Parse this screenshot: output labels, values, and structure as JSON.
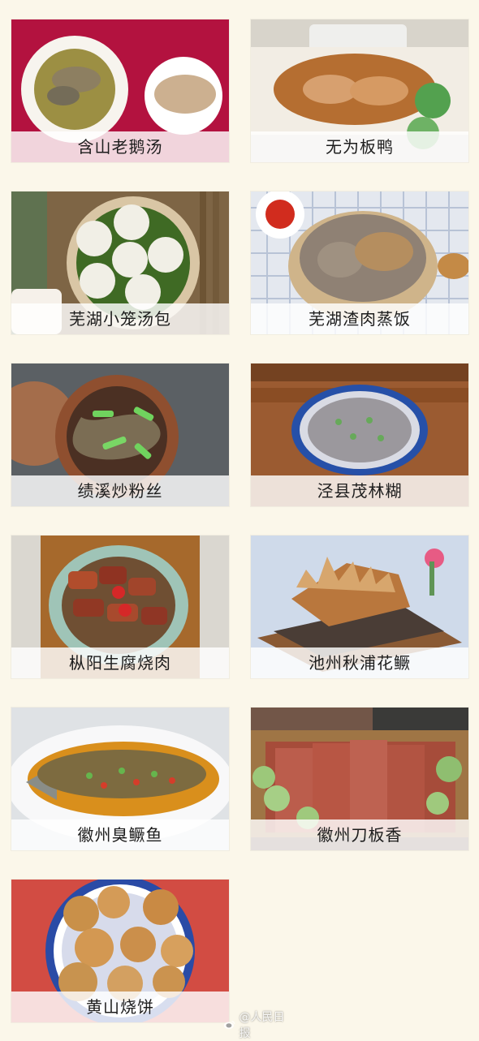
{
  "page": {
    "background_color": "#fbf7ea"
  },
  "dishes": [
    {
      "label": "含山老鹅汤"
    },
    {
      "label": "无为板鸭"
    },
    {
      "label": "芜湖小笼汤包"
    },
    {
      "label": "芜湖渣肉蒸饭"
    },
    {
      "label": "绩溪炒粉丝"
    },
    {
      "label": "泾县茂林糊"
    },
    {
      "label": "枞阳生腐烧肉"
    },
    {
      "label": "池州秋浦花鳜"
    },
    {
      "label": "徽州臭鳜鱼"
    },
    {
      "label": "徽州刀板香"
    },
    {
      "label": "黄山烧饼"
    }
  ],
  "watermark": {
    "text": "@人民日报",
    "icon": "weibo-icon"
  }
}
